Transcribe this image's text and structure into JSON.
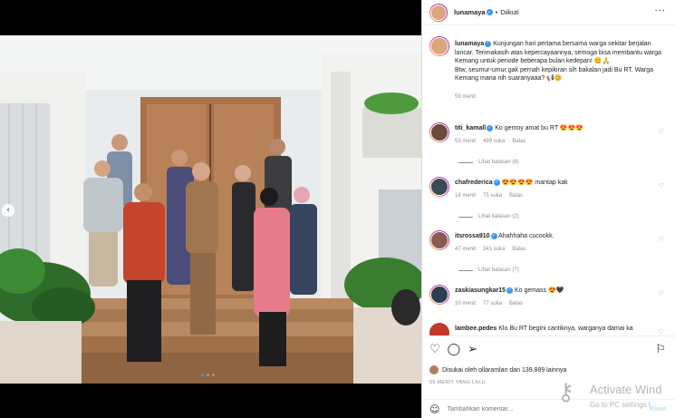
{
  "header": {
    "username": "lunamaya",
    "separator": "•",
    "follow_status": "Diikuti",
    "more_icon": "more-horizontal-icon"
  },
  "caption": {
    "username": "lunamaya",
    "text_1": "Kunjungan hari pertama bersama warga sekitar berjalan lancar. Terimakasih atas kepercayaannya, semoga bisa membantu warga Kemang untuk periode beberapa bulan kedepan! 😊🙏",
    "text_2": "Btw, seumur-umur gak pernah kepikiran sih bakalan jadi Bu RT. Warga Kemang mana nih suaranyaaa? 📢😊",
    "time": "59 menit"
  },
  "comments": [
    {
      "username": "titi_kamall",
      "text": "Ko gemoy amat bu RT 😍😍😍",
      "time": "53 menit",
      "likes": "499 suka",
      "reply": "Balas",
      "view_replies": "Lihat balasan (8)",
      "avatar_color": "#6b4a3a"
    },
    {
      "username": "chafrederica",
      "text": "😍😍😍😍 mantap kak",
      "time": "18 menit",
      "likes": "75 suka",
      "reply": "Balas",
      "view_replies": "Lihat balasan (2)",
      "avatar_color": "#3a4a55"
    },
    {
      "username": "itsrossa910",
      "text": "Ahahhaha cucookk.",
      "time": "47 menit",
      "likes": "341 suka",
      "reply": "Balas",
      "view_replies": "Lihat balasan (7)",
      "avatar_color": "#8a5a50"
    },
    {
      "username": "zaskiasungkar15",
      "text": "Ko gemass 😍🖤",
      "time": "10 menit",
      "likes": "77 suka",
      "reply": "Balas",
      "view_replies": "",
      "avatar_color": "#2c3e50"
    },
    {
      "username": "lambee.pedes",
      "text": "Klo Bu RT begini cantiknya, warganya damai ka",
      "time": "",
      "likes": "",
      "reply": "",
      "view_replies": "",
      "avatar_color": "#c0392b"
    }
  ],
  "actions": {
    "like_icon": "heart-icon",
    "comment_icon": "comment-icon",
    "share_icon": "share-icon",
    "save_icon": "bookmark-icon",
    "liked_by": "Disukai oleh ollaramlan dan 139,889 lainnya",
    "posted_time": "59 MENIT YANG LALU",
    "emoji_icon": "smiley-icon",
    "comment_placeholder": "Tambahkan komentar...",
    "post_label": "Kirim"
  },
  "watermark": {
    "line1": "Activate Wind",
    "line2": "Go to PC settings t"
  },
  "colors": {
    "accent": "#3897f0",
    "post_disabled": "#b2dffc"
  }
}
